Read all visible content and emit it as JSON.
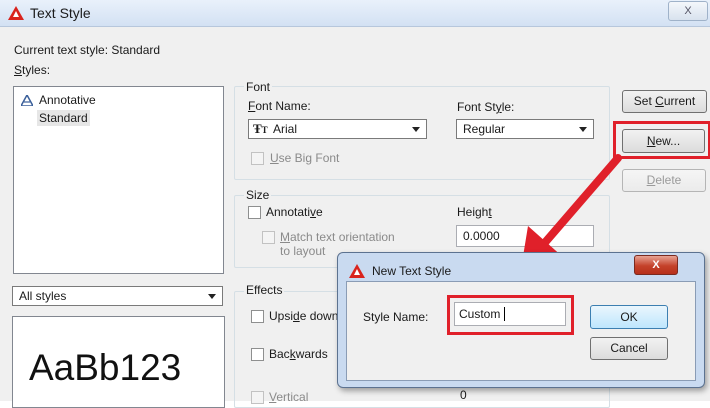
{
  "window": {
    "title": "Text Style",
    "close": "X"
  },
  "current_style": "Current text style:  Standard",
  "styles": {
    "label": "Styles:",
    "items": [
      "Annotative",
      "Standard"
    ],
    "filter": "All styles",
    "preview_text": "AaBb123"
  },
  "font": {
    "group_label": "Font",
    "name_label": "Font Name:",
    "name_value": "Arial",
    "style_label": "Font Style:",
    "style_value": "Regular",
    "big_font_label": "Use Big Font"
  },
  "size": {
    "group_label": "Size",
    "annotative_label": "Annotative",
    "match_label": "Match text orientation",
    "match_label2": "to layout",
    "height_label": "Height",
    "height_value": "0.0000"
  },
  "effects": {
    "group_label": "Effects",
    "upside_down": "Upside down",
    "backwards": "Backwards",
    "vertical": "Vertical",
    "partial_value": "0"
  },
  "buttons": {
    "set_current": "Set Current",
    "new": "New...",
    "delete": "Delete"
  },
  "dialog": {
    "title": "New Text Style",
    "close": "X",
    "style_name_label": "Style Name:",
    "style_name_value": "Custom",
    "ok": "OK",
    "cancel": "Cancel"
  },
  "colors": {
    "highlight": "#e0202a",
    "arrow": "#e0202a",
    "title_bg": "#dce7f5"
  }
}
